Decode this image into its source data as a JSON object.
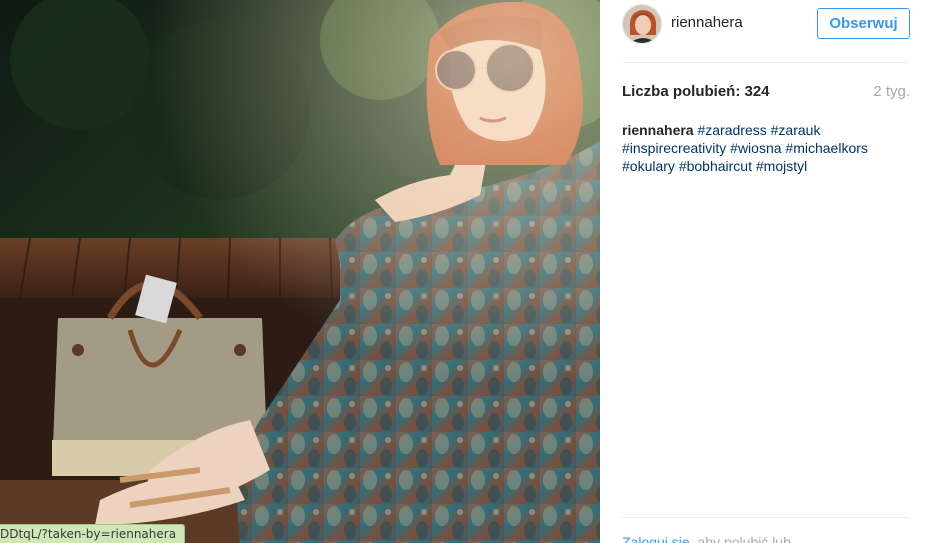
{
  "photo": {
    "alt": "post-photo",
    "status_url": "DDtqL/?taken-by=riennahera"
  },
  "post": {
    "username": "riennahera",
    "follow_label": "Obserwuj",
    "likes": "Liczba polubień: 324",
    "time_ago": "2 tyg.",
    "caption": {
      "author": "riennahera",
      "tags": [
        "#zaradress",
        "#zarauk",
        "#inspirecreativity",
        "#wiosna",
        "#michaelkors",
        "#okulary",
        "#bobhaircut",
        "#mojstyl"
      ]
    },
    "footer": {
      "login_link": "Zaloguj się",
      "rest": ", aby polubić lub"
    }
  },
  "colors": {
    "accent": "#3897f0",
    "tag": "#003569",
    "muted": "#a5a7aa"
  }
}
